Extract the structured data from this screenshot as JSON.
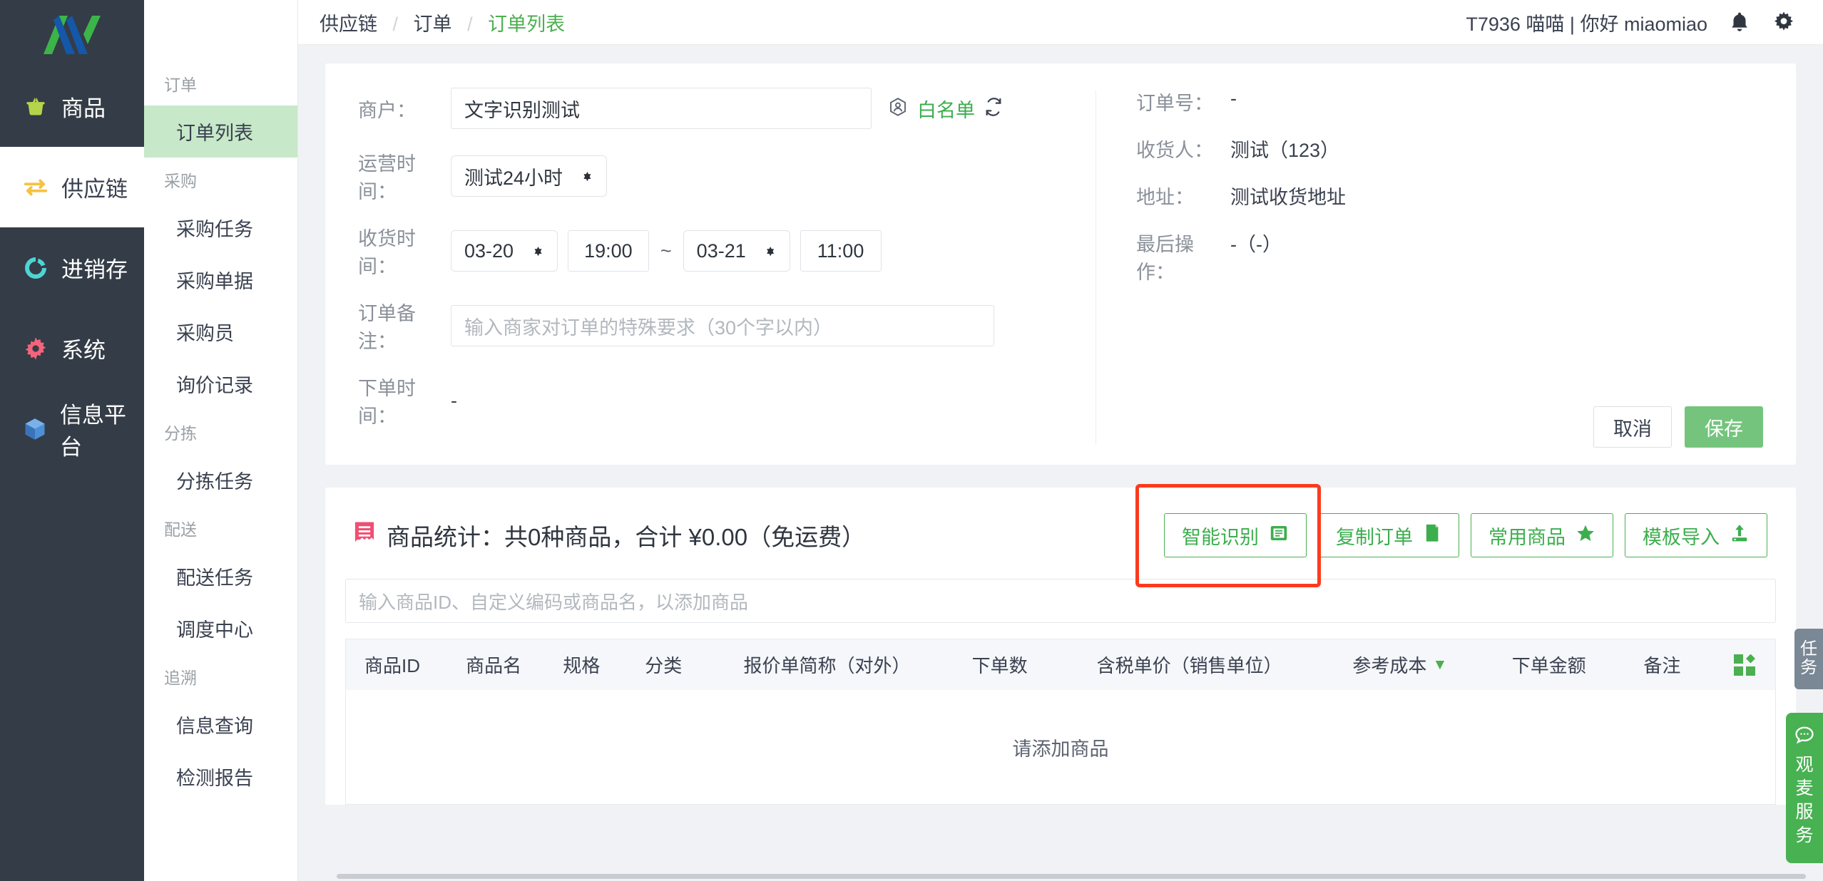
{
  "rail": {
    "items": [
      {
        "label": "商品",
        "icon": "basket-icon"
      },
      {
        "label": "供应链",
        "icon": "exchange-icon"
      },
      {
        "label": "进销存",
        "icon": "inventory-icon"
      },
      {
        "label": "系统",
        "icon": "gear-icon"
      },
      {
        "label": "信息平台",
        "icon": "cube-icon"
      }
    ]
  },
  "subnav": {
    "groups": [
      {
        "title": "订单",
        "items": [
          "订单列表"
        ]
      },
      {
        "title": "采购",
        "items": [
          "采购任务",
          "采购单据",
          "采购员",
          "询价记录"
        ]
      },
      {
        "title": "分拣",
        "items": [
          "分拣任务"
        ]
      },
      {
        "title": "配送",
        "items": [
          "配送任务",
          "调度中心"
        ]
      },
      {
        "title": "追溯",
        "items": [
          "信息查询",
          "检测报告"
        ]
      }
    ],
    "active": "订单列表"
  },
  "header": {
    "breadcrumb": {
      "root": "供应链",
      "mid": "订单",
      "current": "订单列表",
      "separator": "/"
    },
    "user": "T7936 喵喵 | 你好 miaomiao",
    "bell_icon": "bell-icon",
    "gear_icon": "gear-icon"
  },
  "form": {
    "merchant": {
      "label": "商户：",
      "value": "文字识别测试"
    },
    "whitelist": {
      "label": "白名单",
      "icon": "user-hex-icon",
      "refresh_icon": "refresh-icon"
    },
    "operating_time": {
      "label": "运营时间：",
      "value": "测试24小时"
    },
    "receive_time": {
      "label": "收货时间：",
      "start_date": "03-20",
      "start_time": "19:00",
      "separator": "~",
      "end_date": "03-21",
      "end_time": "11:00"
    },
    "remark": {
      "label": "订单备注：",
      "placeholder": "输入商家对订单的特殊要求（30个字以内）",
      "value": ""
    },
    "order_time": {
      "label": "下单时间：",
      "value": "-"
    }
  },
  "info": {
    "rows": [
      {
        "label": "订单号：",
        "value": "-"
      },
      {
        "label": "收货人：",
        "value": "测试（123）"
      },
      {
        "label": "地址：",
        "value": "测试收货地址"
      },
      {
        "label": "最后操作：",
        "value": "-（-）"
      }
    ],
    "cancel": "取消",
    "save": "保存"
  },
  "goods": {
    "title": "商品统计：共0种商品，合计 ¥0.00（免运费）",
    "title_icon": "receipt-icon",
    "actions": [
      {
        "label": "智能识别",
        "icon": "scan-icon",
        "highlighted": true
      },
      {
        "label": "复制订单",
        "icon": "copy-icon",
        "highlighted": false
      },
      {
        "label": "常用商品",
        "icon": "star-icon",
        "highlighted": false
      },
      {
        "label": "模板导入",
        "icon": "upload-icon",
        "highlighted": false
      }
    ],
    "search_placeholder": "输入商品ID、自定义编码或商品名，以添加商品",
    "columns": [
      "商品ID",
      "商品名",
      "规格",
      "分类",
      "报价单简称（对外）",
      "下单数",
      "含税单价（销售单位）",
      "参考成本",
      "下单金额",
      "备注"
    ],
    "sorted_column": "参考成本",
    "sort_icon": "sort-desc-icon",
    "settings_icon": "column-settings-icon",
    "empty_text": "请添加商品"
  },
  "floating": {
    "task_tab": "任务",
    "service_tab": "观麦服务",
    "service_icon": "chat-icon"
  },
  "colors": {
    "brand_green": "#4caf50",
    "sidebar_dark": "#343c47",
    "active_green": "#c7e8c9",
    "highlight_red": "#fb3b1e",
    "save_green": "#74c47d"
  }
}
